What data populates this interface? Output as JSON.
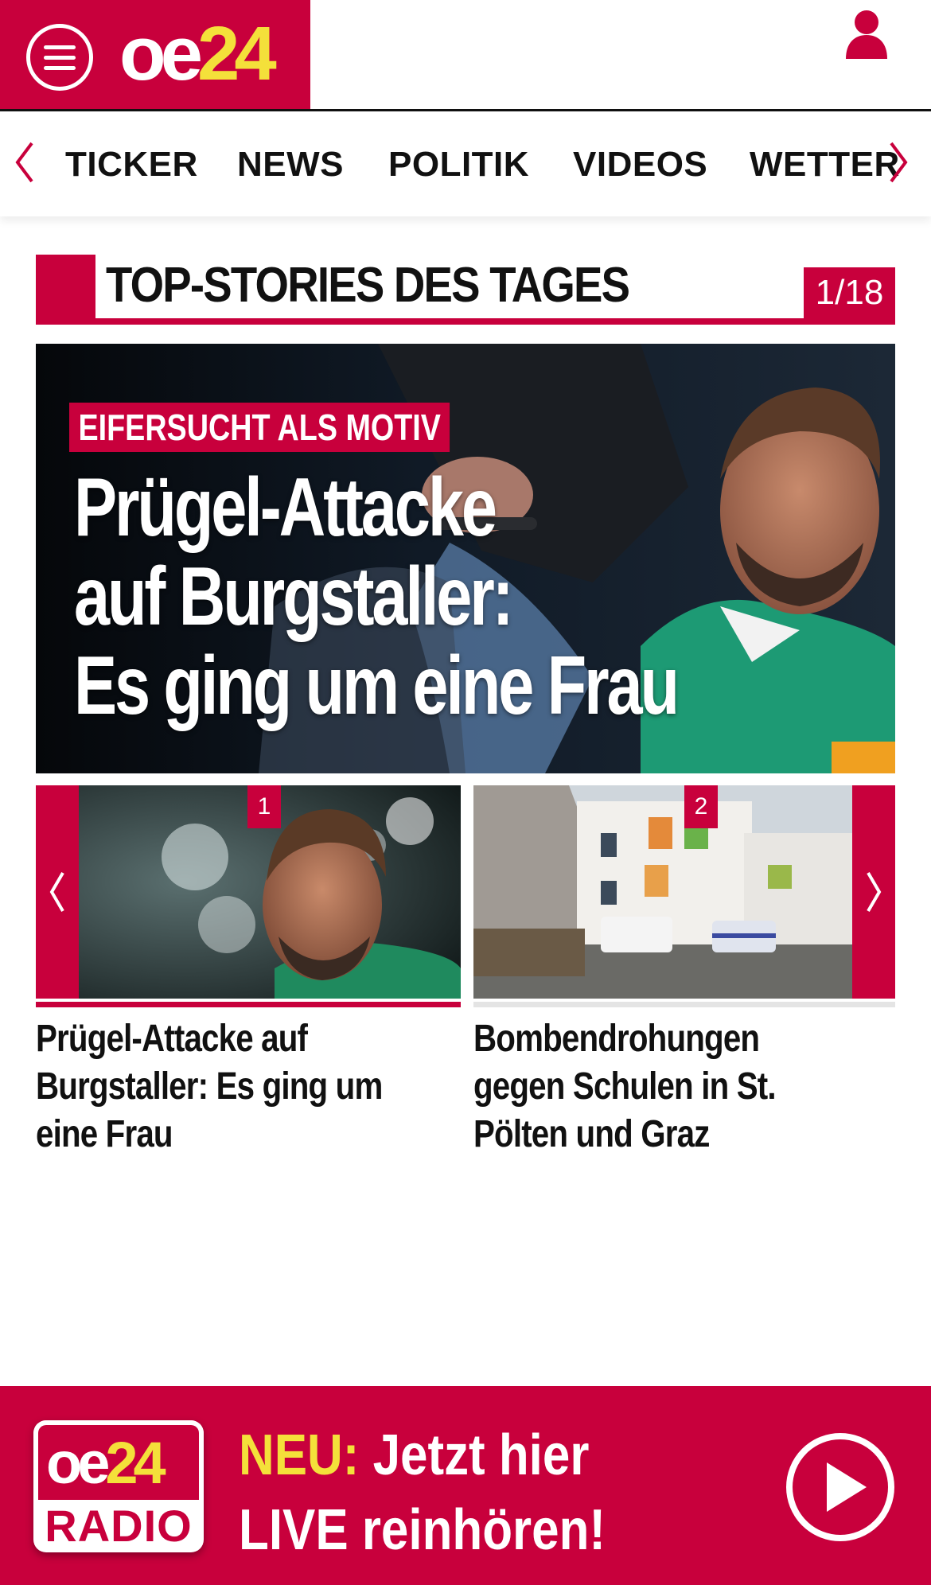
{
  "header": {
    "logo_oe": "oe",
    "logo_num": "24",
    "menu_icon": "hamburger-menu-icon",
    "user_icon": "user-icon"
  },
  "nav": {
    "items": [
      "TICKER",
      "NEWS",
      "POLITIK",
      "VIDEOS",
      "WETTER"
    ],
    "left_icon": "chevron-left-icon",
    "right_icon": "chevron-right-icon"
  },
  "section": {
    "title": "TOP-STORIES DES TAGES",
    "counter": "1/18"
  },
  "hero": {
    "kicker": "EIFERSUCHT ALS MOTIV",
    "title_lines": [
      "Prügel-Attacke",
      "auf Burgstaller:",
      "Es ging um eine Frau"
    ]
  },
  "teasers": [
    {
      "badge": "1",
      "title": "Prügel-Attacke auf Burgstaller: Es ging um eine Frau",
      "active": true
    },
    {
      "badge": "2",
      "title": "Bombendrohungen gegen Schulen in St. Pölten und Graz",
      "active": false
    }
  ],
  "radio": {
    "logo_oe": "oe",
    "logo_num": "24",
    "logo_label": "RADIO",
    "neu": "NEU:",
    "line1": "Jetzt hier",
    "line2": "LIVE reinhören!",
    "play_icon": "play-icon"
  },
  "colors": {
    "brand_red": "#c8003c",
    "logo_yellow": "#f4e03a",
    "text": "#111111"
  }
}
